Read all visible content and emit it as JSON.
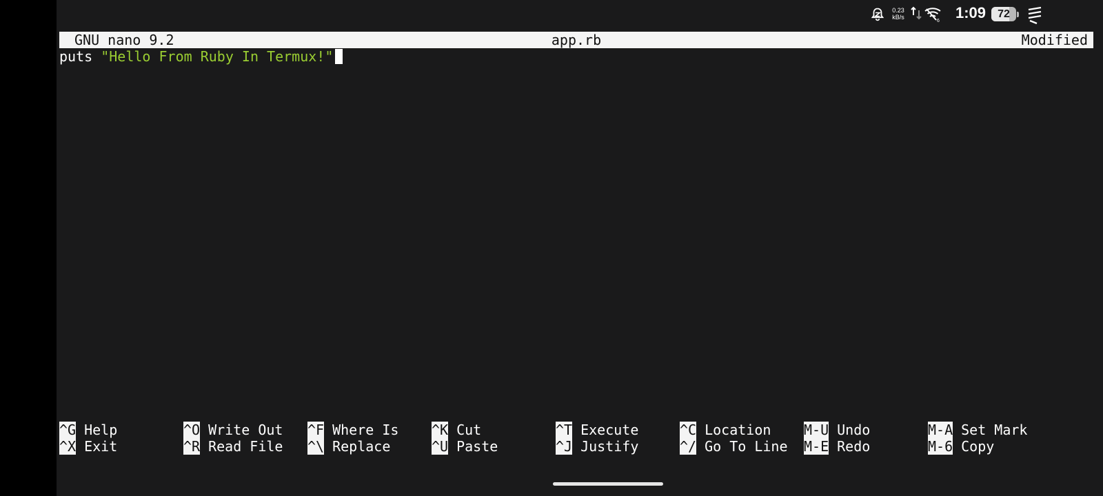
{
  "status_bar": {
    "net_speed_value": "0.23",
    "net_speed_unit": "kB/s",
    "clock": "1:09",
    "battery_percent": "72",
    "battery_level": 0.72,
    "icons": [
      "bell-off-icon",
      "upload-download-icon",
      "wifi-icon",
      "termux-notification-icon"
    ]
  },
  "nano": {
    "version": "GNU nano 9.2",
    "filename": "app.rb",
    "status": "Modified"
  },
  "editor": {
    "keyword": "puts",
    "string_literal": "\"Hello From Ruby In Termux!\"",
    "colors": {
      "background": "#1a1a1b",
      "string": "#9acd32",
      "text": "#ffffff"
    }
  },
  "shortcuts": [
    [
      {
        "key": "^G",
        "label": "Help"
      },
      {
        "key": "^O",
        "label": "Write Out"
      },
      {
        "key": "^F",
        "label": "Where Is"
      },
      {
        "key": "^K",
        "label": "Cut"
      },
      {
        "key": "^T",
        "label": "Execute"
      },
      {
        "key": "^C",
        "label": "Location"
      },
      {
        "key": "M-U",
        "label": "Undo"
      },
      {
        "key": "M-A",
        "label": "Set Mark"
      }
    ],
    [
      {
        "key": "^X",
        "label": "Exit"
      },
      {
        "key": "^R",
        "label": "Read File"
      },
      {
        "key": "^\\",
        "label": "Replace"
      },
      {
        "key": "^U",
        "label": "Paste"
      },
      {
        "key": "^J",
        "label": "Justify"
      },
      {
        "key": "^/",
        "label": "Go To Line"
      },
      {
        "key": "M-E",
        "label": "Redo"
      },
      {
        "key": "M-6",
        "label": "Copy"
      }
    ]
  ]
}
